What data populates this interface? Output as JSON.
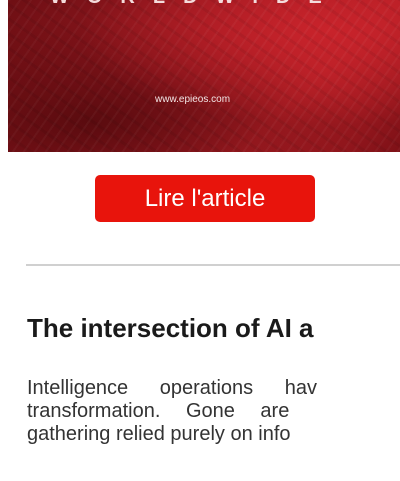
{
  "banner": {
    "headline": "WORLDWIDE",
    "url": "www.epieos.com"
  },
  "cta": {
    "label": "Lire l'article"
  },
  "article": {
    "title": "The intersection of AI a",
    "body_lines": [
      "Intelligence operations hav",
      "transformation. Gone are",
      "gathering relied purely on info"
    ]
  },
  "colors": {
    "cta_background": "#e8140c",
    "banner_red": "#9b1820",
    "divider": "#d0d0d0"
  }
}
